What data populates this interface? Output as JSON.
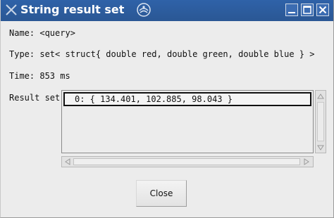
{
  "window": {
    "title": "String result set",
    "buttons": {
      "minimize_icon": "minimize-icon",
      "maximize_icon": "maximize-icon",
      "close_icon": "close-icon"
    }
  },
  "info": {
    "name_line": "Name: <query>",
    "type_line": "Type: set< struct{ double red, double green, double blue } >",
    "time_line": "Time: 853 ms"
  },
  "result_set": {
    "label": "Result set",
    "items": [
      "0: { 134.401, 102.885, 98.043 }"
    ]
  },
  "footer": {
    "close_label": "Close"
  },
  "colors": {
    "titlebar": "#2f62a8",
    "window_bg": "#ececec",
    "selection_border": "#111111"
  }
}
